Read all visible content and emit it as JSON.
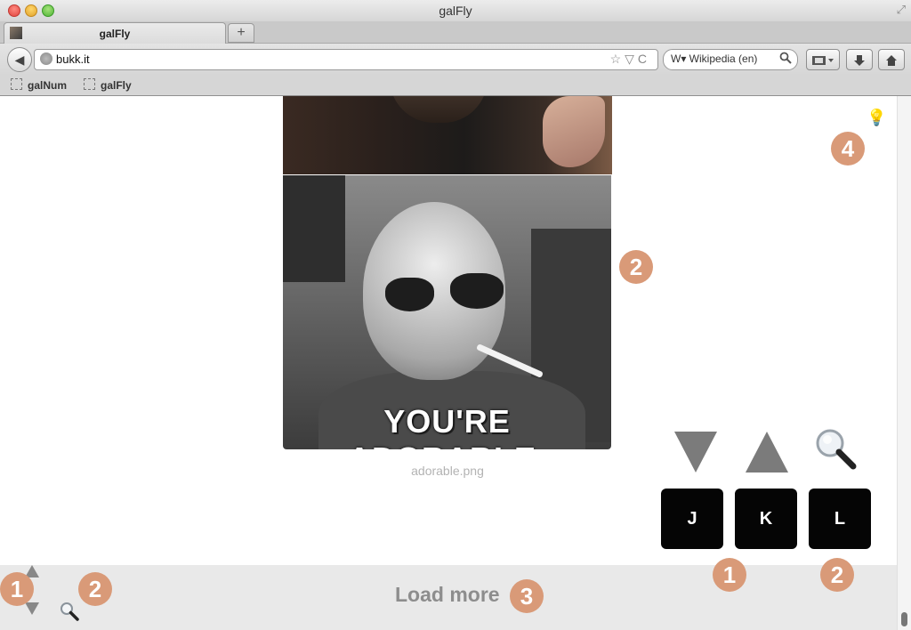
{
  "window": {
    "title": "galFly"
  },
  "tabs": [
    {
      "label": "galFly"
    }
  ],
  "newtab_label": "+",
  "navbar": {
    "back_label": "◀",
    "url": "bukk.it",
    "url_icons": "☆▽C",
    "search_engine": "W▾ Wikipedia (en)",
    "search_icon": "magnifier-icon"
  },
  "bookmarks": [
    {
      "label": "galNum"
    },
    {
      "label": "galFly"
    }
  ],
  "gallery": {
    "meme_text": "YOU'RE ADORABLE.",
    "caption": "adorable.png"
  },
  "keys": {
    "j": "J",
    "k": "K",
    "l": "L"
  },
  "badges": {
    "image_side": "2",
    "top_right": "4",
    "key_j": "1",
    "key_l": "2",
    "footer_left_1": "1",
    "footer_left_2": "2",
    "footer_load": "3"
  },
  "footer": {
    "load_more": "Load more"
  },
  "colors": {
    "badge": "#d99a78",
    "key_bg": "#050505",
    "footer_bg": "#e9e9e9",
    "arrow": "#7b7b7b"
  }
}
